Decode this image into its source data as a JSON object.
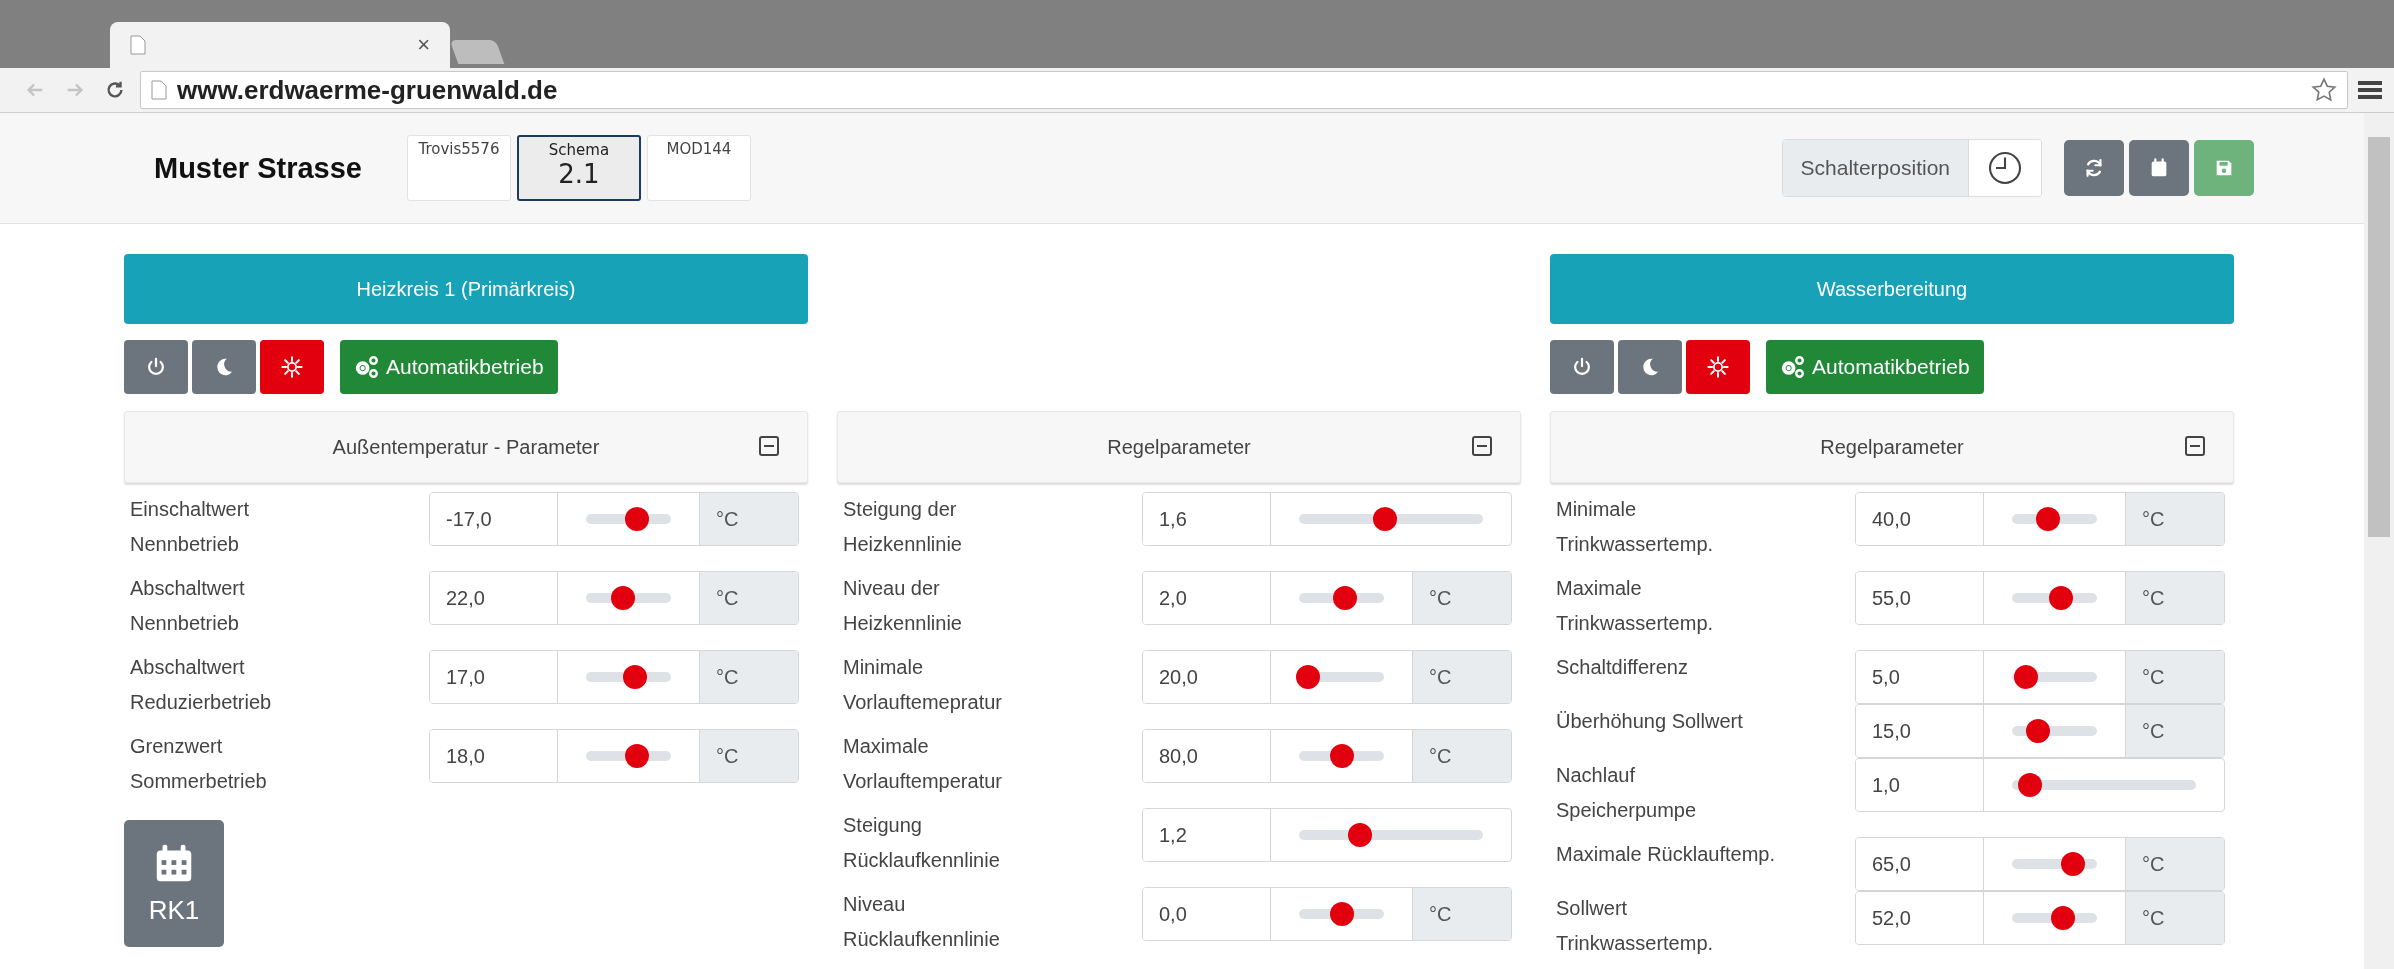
{
  "browser": {
    "tab_close": "×",
    "nav": [
      {
        "kind": "back",
        "disabled": true
      },
      {
        "kind": "forward",
        "disabled": true
      },
      {
        "kind": "reload",
        "disabled": false
      }
    ],
    "url": "www.erdwaerme-gruenwald.de"
  },
  "header": {
    "title": "Muster Strasse",
    "devices": [
      {
        "label": "Trovis5576",
        "selected": false
      },
      {
        "label": "Schema",
        "sublabel": "2.1",
        "selected": true
      },
      {
        "label": "MOD144",
        "selected": false
      }
    ],
    "switch_position": {
      "label": "Schalterposition"
    },
    "actions": [
      {
        "kind": "refresh",
        "color": "#6c757d"
      },
      {
        "kind": "calendar",
        "color": "#6c757d"
      },
      {
        "kind": "save",
        "color": "#6db37b"
      }
    ]
  },
  "columns": [
    {
      "title": "Heizkreis 1 (Primärkreis)",
      "modes": [
        {
          "kind": "power",
          "color": "#6c757d"
        },
        {
          "kind": "night",
          "color": "#6c757d"
        },
        {
          "kind": "day",
          "color": "#e2000f"
        },
        {
          "kind": "auto",
          "label": "Automatikbetrieb",
          "color": "#218838"
        }
      ],
      "panel": {
        "title": "Außentemperatur - Parameter",
        "expanded": true,
        "rows": [
          {
            "label": "Einschaltwert\nNennbetrieb",
            "value": "-17,0",
            "level": 0.6,
            "unit": "°C"
          },
          {
            "label": "Abschaltwert\nNennbetrieb",
            "value": "22,0",
            "level": 0.44,
            "unit": "°C"
          },
          {
            "label": "Abschaltwert\nReduzierbetrieb",
            "value": "17,0",
            "level": 0.58,
            "unit": "°C"
          },
          {
            "label": "Grenzwert\nSommerbetrieb",
            "value": "18,0",
            "level": 0.6,
            "unit": "°C"
          }
        ]
      },
      "schedule": {
        "label": "RK1"
      }
    },
    {
      "panel": {
        "title": "Regelparameter",
        "expanded": true,
        "rows": [
          {
            "label": "Steigung der\nHeizkennlinie",
            "value": "1,6",
            "level": 0.47
          },
          {
            "label": "Niveau der\nHeizkennlinie",
            "value": "2,0",
            "level": 0.54,
            "unit": "°C"
          },
          {
            "label": "Minimale\nVorlauftemepratur",
            "value": "20,0",
            "level": 0.11,
            "unit": "°C"
          },
          {
            "label": "Maximale\nVorlauftemperatur",
            "value": "80,0",
            "level": 0.51,
            "unit": "°C"
          },
          {
            "label": "Steigung\nRücklaufkennlinie",
            "value": "1,2",
            "level": 0.33
          },
          {
            "label": "Niveau\nRücklaufkennlinie",
            "value": "0,0",
            "level": 0.5,
            "unit": "°C"
          }
        ]
      }
    },
    {
      "title": "Wasserbereitung",
      "modes": [
        {
          "kind": "power",
          "color": "#6c757d"
        },
        {
          "kind": "night",
          "color": "#6c757d"
        },
        {
          "kind": "day",
          "color": "#e2000f"
        },
        {
          "kind": "auto",
          "label": "Automatikbetrieb",
          "color": "#218838"
        }
      ],
      "panel": {
        "title": "Regelparameter",
        "expanded": true,
        "rows": [
          {
            "label": "Minimale\nTrinkwassertemp.",
            "value": "40,0",
            "level": 0.42,
            "unit": "°C"
          },
          {
            "label": "Maximale\nTrinkwassertemp.",
            "value": "55,0",
            "level": 0.58,
            "unit": "°C"
          },
          {
            "label": "Schaltdifferenz",
            "value": "5,0",
            "level": 0.16,
            "unit": "°C"
          },
          {
            "label": "Überhöhung Sollwert",
            "value": "15,0",
            "level": 0.3,
            "unit": "°C"
          },
          {
            "label": "Nachlauf\nSpeicherpumpe",
            "value": "1,0",
            "level": 0.1
          },
          {
            "label": "Maximale Rücklauftemp.",
            "value": "65,0",
            "level": 0.72,
            "unit": "°C"
          },
          {
            "label": "Sollwert\nTrinkwassertemp.",
            "value": "52,0",
            "level": 0.6,
            "unit": "°C"
          }
        ]
      }
    }
  ]
}
